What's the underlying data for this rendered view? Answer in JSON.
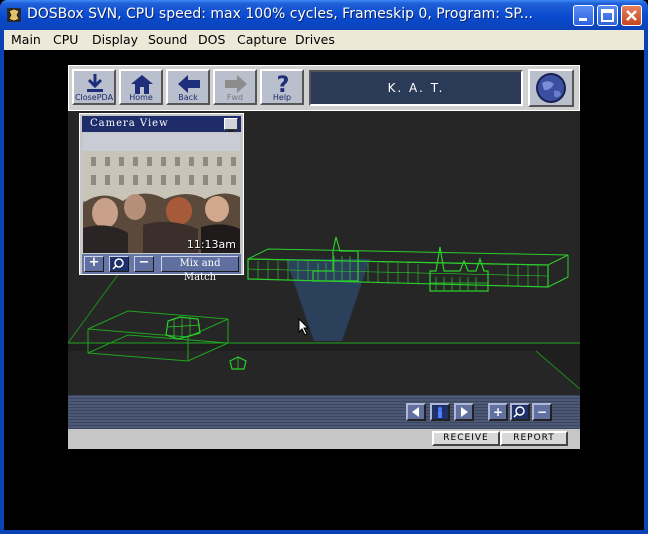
{
  "window": {
    "title": "DOSBox SVN, CPU speed: max 100% cycles, Frameskip  0, Program:    SP...",
    "controls": {
      "minimize": "minimize",
      "maximize": "maximize",
      "close": "close"
    }
  },
  "menubar": {
    "items": [
      "Main",
      "CPU",
      "Display",
      "Sound",
      "DOS",
      "Capture",
      "Drives"
    ]
  },
  "pda": {
    "toolbar": {
      "buttons": [
        {
          "label": "ClosePDA",
          "icon": "download-arrow-icon",
          "enabled": true
        },
        {
          "label": "Home",
          "icon": "home-icon",
          "enabled": true
        },
        {
          "label": "Back",
          "icon": "back-arrow-icon",
          "enabled": true
        },
        {
          "label": "Fwd",
          "icon": "forward-arrow-icon",
          "enabled": false
        },
        {
          "label": "Help",
          "icon": "question-icon",
          "enabled": true
        }
      ],
      "title_panel": "K. A. T.",
      "globe_icon": "globe-icon"
    },
    "camera_view": {
      "title": "Camera View",
      "timestamp": "11:13am",
      "mix_button": "Mix and Match",
      "controls": [
        "+",
        "zoom",
        "−"
      ]
    },
    "map_controls": {
      "nav": [
        "prev-arrow-icon",
        "person-icon",
        "next-arrow-icon"
      ],
      "zoom": [
        "+",
        "zoom",
        "−"
      ]
    },
    "status_buttons": {
      "receive": "RECEIVE",
      "report": "REPORT"
    }
  },
  "colors": {
    "wireframe": "#2ccf2c",
    "scene_bg": "#262626",
    "titlebar": "#0a4ad0",
    "kat_panel": "#2b3a57"
  }
}
